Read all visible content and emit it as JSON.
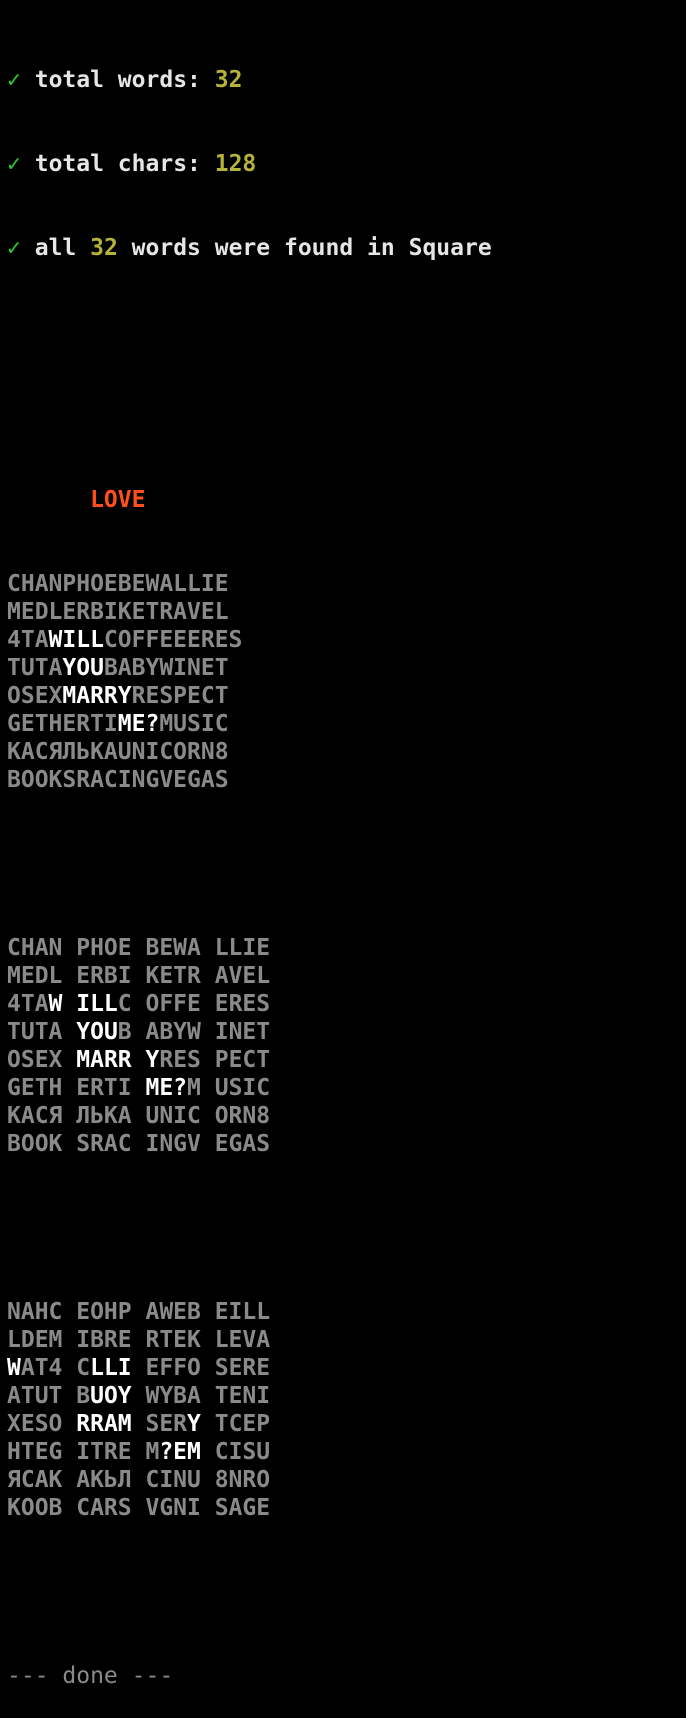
{
  "summary": {
    "check_mark": "✓",
    "line1_label": "total words: ",
    "line1_value": "32",
    "line2_label": "total chars: ",
    "line2_value": "128",
    "line3_prefix": "all ",
    "line3_value": "32",
    "line3_suffix": " words were found in Square"
  },
  "heading": "      LOVE",
  "grid_lines": [
    [
      {
        "t": "CHANPHOEBEWALLIE",
        "h": false
      }
    ],
    [
      {
        "t": "MEDLERBIKETRAVEL",
        "h": false
      }
    ],
    [
      {
        "t": "4TA",
        "h": false
      },
      {
        "t": "WILL",
        "h": true
      },
      {
        "t": "COFFEEERES",
        "h": false
      }
    ],
    [
      {
        "t": "TUTA",
        "h": false
      },
      {
        "t": "YOU",
        "h": true
      },
      {
        "t": "BABYWINET",
        "h": false
      }
    ],
    [
      {
        "t": "OSEX",
        "h": false
      },
      {
        "t": "MARRY",
        "h": true
      },
      {
        "t": "RESPECT",
        "h": false
      }
    ],
    [
      {
        "t": "GETHERTI",
        "h": false
      },
      {
        "t": "ME?",
        "h": true
      },
      {
        "t": "MUSIC",
        "h": false
      }
    ],
    [
      {
        "t": "КАСЯЛЬКАUNICORN8",
        "h": false
      }
    ],
    [
      {
        "t": "BOOKSRACINGVEGAS",
        "h": false
      }
    ]
  ],
  "block_lines": [
    [
      {
        "t": "CHAN PHOE BEWA LLIE",
        "h": false
      }
    ],
    [
      {
        "t": "MEDL ERBI KETR AVEL",
        "h": false
      }
    ],
    [
      {
        "t": "4TA",
        "h": false
      },
      {
        "t": "W ILL",
        "h": true
      },
      {
        "t": "C OFFE ERES",
        "h": false
      }
    ],
    [
      {
        "t": "TUTA ",
        "h": false
      },
      {
        "t": "YOU",
        "h": true
      },
      {
        "t": "B ABYW INET",
        "h": false
      }
    ],
    [
      {
        "t": "OSEX ",
        "h": false
      },
      {
        "t": "MARR Y",
        "h": true
      },
      {
        "t": "RES PECT",
        "h": false
      }
    ],
    [
      {
        "t": "GETH ERTI ",
        "h": false
      },
      {
        "t": "ME?",
        "h": true
      },
      {
        "t": "M USIC",
        "h": false
      }
    ],
    [
      {
        "t": "КАСЯ ЛЬКА UNIC ORN8",
        "h": false
      }
    ],
    [
      {
        "t": "BOOK SRAC INGV EGAS",
        "h": false
      }
    ]
  ],
  "reversed_lines": [
    [
      {
        "t": "NAHC EOHP AWEB EILL",
        "h": false
      }
    ],
    [
      {
        "t": "LDEM IBRE RTEK LEVA",
        "h": false
      }
    ],
    [
      {
        "t": "W",
        "h": true
      },
      {
        "t": "AT4 C",
        "h": false
      },
      {
        "t": "LLI",
        "h": true
      },
      {
        "t": " EFFO SERE",
        "h": false
      }
    ],
    [
      {
        "t": "ATUT B",
        "h": false
      },
      {
        "t": "UOY",
        "h": true
      },
      {
        "t": " WYBA TENI",
        "h": false
      }
    ],
    [
      {
        "t": "XESO ",
        "h": false
      },
      {
        "t": "RRAM",
        "h": true
      },
      {
        "t": " SER",
        "h": false
      },
      {
        "t": "Y",
        "h": true
      },
      {
        "t": " TCEP",
        "h": false
      }
    ],
    [
      {
        "t": "HTEG ITRE M",
        "h": false
      },
      {
        "t": "?EM",
        "h": true
      },
      {
        "t": " CISU",
        "h": false
      }
    ],
    [
      {
        "t": "ЯСАК АКЬЛ CINU 8NRO",
        "h": false
      }
    ],
    [
      {
        "t": "KOOB CARS VGNI SAGE",
        "h": false
      }
    ]
  ],
  "footer": "--- done ---"
}
